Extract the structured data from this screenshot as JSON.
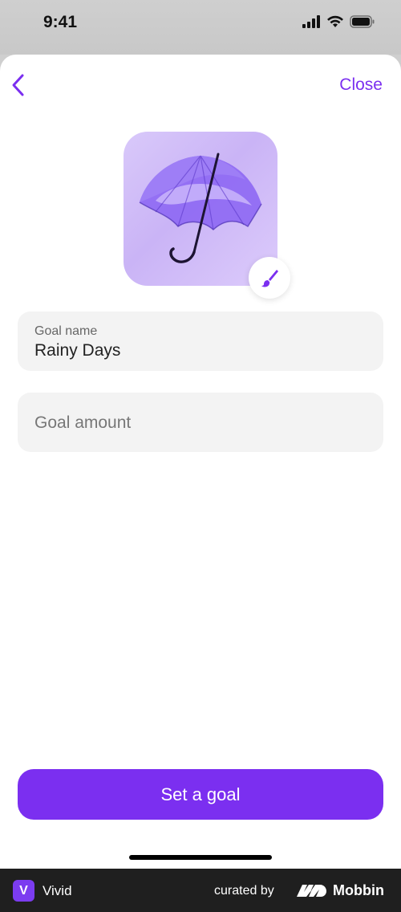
{
  "status_bar": {
    "time": "9:41",
    "icons": [
      "signal-icon",
      "wifi-icon",
      "battery-icon"
    ]
  },
  "nav": {
    "back_icon": "chevron-left-icon",
    "close_label": "Close"
  },
  "goal_image": {
    "icon": "umbrella-icon",
    "edit_icon": "paintbrush-icon"
  },
  "form": {
    "goal_name": {
      "label": "Goal name",
      "value": "Rainy Days"
    },
    "goal_amount": {
      "placeholder": "Goal amount",
      "value": ""
    }
  },
  "primary_action": {
    "label": "Set a goal"
  },
  "footer": {
    "app_logo_letter": "V",
    "app_name": "Vivid",
    "curated_by": "curated by",
    "brand": "Mobbin"
  },
  "colors": {
    "accent": "#7b2ff0",
    "field_bg": "#f3f3f3",
    "footer_bg": "#1f1f1f"
  }
}
